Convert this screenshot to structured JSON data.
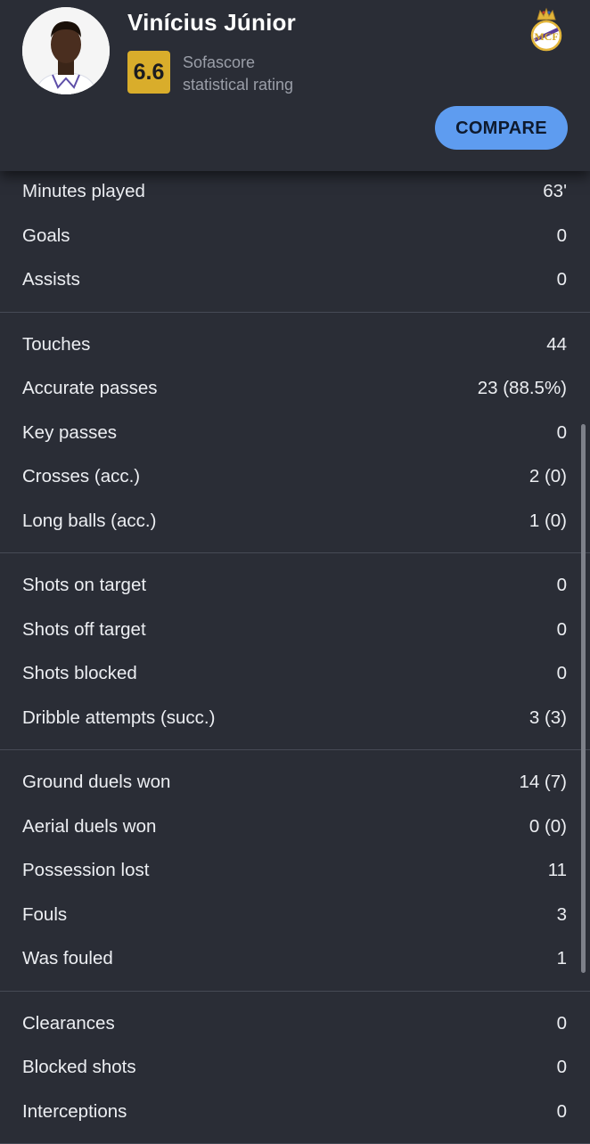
{
  "player": {
    "name": "Vinícius Júnior",
    "rating": "6.6",
    "rating_source_line1": "Sofascore",
    "rating_source_line2": "statistical rating"
  },
  "club": {
    "icon": "real-madrid-crest-icon"
  },
  "compare_label": "COMPARE",
  "colors": {
    "background": "#2a2d36",
    "rating_badge": "#d9ad2b",
    "compare_button": "#5e9cf0",
    "divider": "#464a55"
  },
  "stat_groups": [
    [
      {
        "label": "Minutes played",
        "value": "63'"
      },
      {
        "label": "Goals",
        "value": "0"
      },
      {
        "label": "Assists",
        "value": "0"
      }
    ],
    [
      {
        "label": "Touches",
        "value": "44"
      },
      {
        "label": "Accurate passes",
        "value": "23 (88.5%)"
      },
      {
        "label": "Key passes",
        "value": "0"
      },
      {
        "label": "Crosses (acc.)",
        "value": "2 (0)"
      },
      {
        "label": "Long balls (acc.)",
        "value": "1 (0)"
      }
    ],
    [
      {
        "label": "Shots on target",
        "value": "0"
      },
      {
        "label": "Shots off target",
        "value": "0"
      },
      {
        "label": "Shots blocked",
        "value": "0"
      },
      {
        "label": "Dribble attempts (succ.)",
        "value": "3 (3)"
      }
    ],
    [
      {
        "label": "Ground duels won",
        "value": "14 (7)"
      },
      {
        "label": "Aerial duels won",
        "value": "0 (0)"
      },
      {
        "label": "Possession lost",
        "value": "11"
      },
      {
        "label": "Fouls",
        "value": "3"
      },
      {
        "label": "Was fouled",
        "value": "1"
      }
    ],
    [
      {
        "label": "Clearances",
        "value": "0"
      },
      {
        "label": "Blocked shots",
        "value": "0"
      },
      {
        "label": "Interceptions",
        "value": "0"
      }
    ]
  ]
}
